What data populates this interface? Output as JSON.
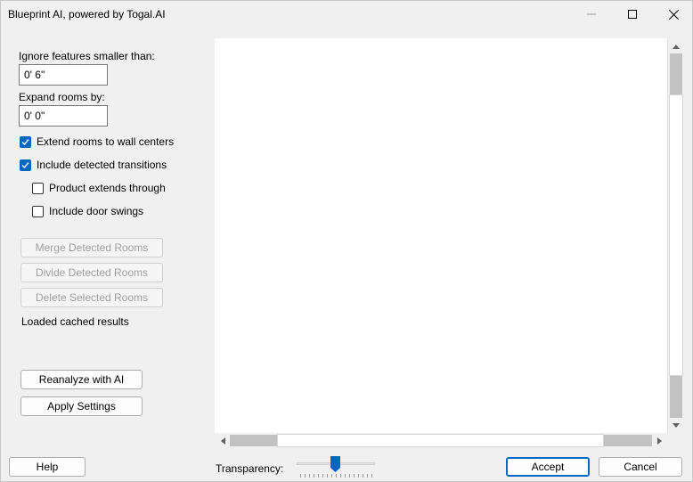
{
  "window": {
    "title": "Blueprint AI, powered by Togal.AI",
    "controls": [
      "minimize-icon",
      "maximize-icon",
      "close-icon"
    ]
  },
  "settings": {
    "ignore_label": "Ignore features smaller than:",
    "ignore_value": "0' 6\"",
    "expand_label": "Expand rooms by:",
    "expand_value": "0' 0\"",
    "checkboxes": [
      {
        "label": "Extend rooms to wall centers",
        "checked": true
      },
      {
        "label": "Include detected transitions",
        "checked": true
      },
      {
        "label": "Product extends through",
        "checked": false
      },
      {
        "label": "Include door swings",
        "checked": false
      }
    ]
  },
  "room_actions": {
    "merge": "Merge Detected Rooms",
    "divide": "Divide Detected Rooms",
    "delete": "Delete Selected Rooms"
  },
  "status": "Loaded cached results",
  "actions": {
    "reanalyze": "Reanalyze with AI",
    "apply": "Apply Settings"
  },
  "footer": {
    "help": "Help",
    "transparency_label": "Transparency:",
    "accept": "Accept",
    "cancel": "Cancel"
  },
  "colors": {
    "accent": "#0067c0",
    "window_bg": "#f0f0f0"
  }
}
